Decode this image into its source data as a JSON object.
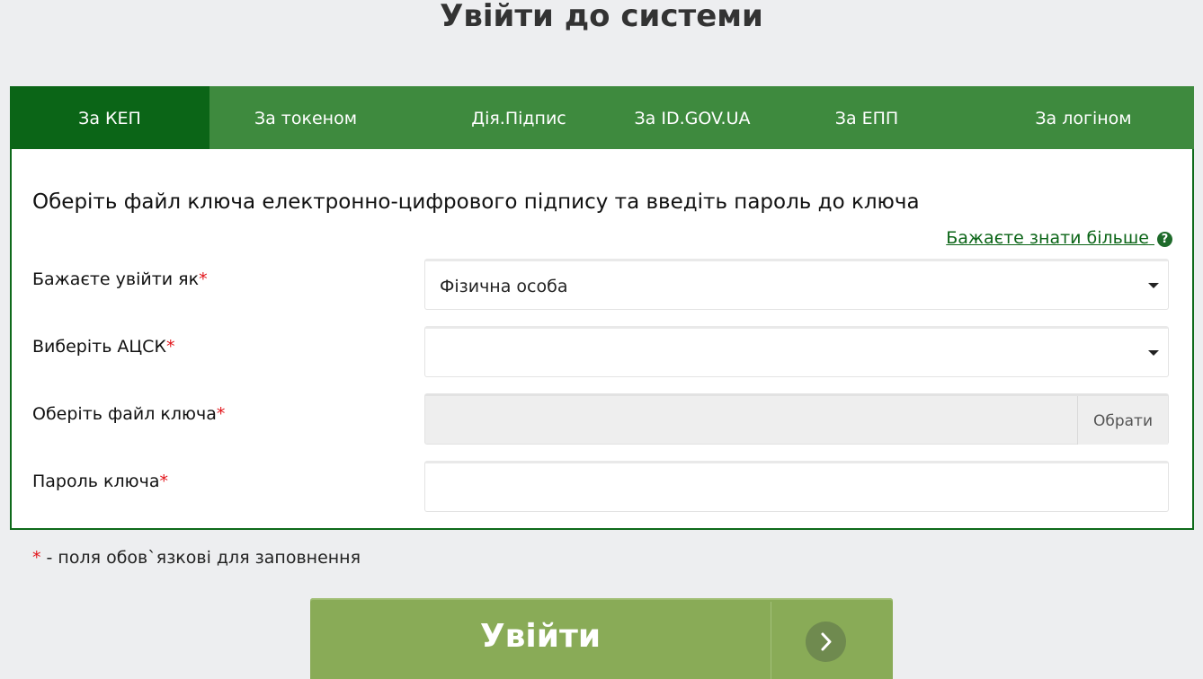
{
  "page": {
    "title": "Увійти до системи"
  },
  "tabs": [
    {
      "label": "За КЕП",
      "active": true
    },
    {
      "label": "За токеном",
      "active": false
    },
    {
      "label": "Дія.Підпис",
      "active": false
    },
    {
      "label": "За ID.GOV.UA",
      "active": false
    },
    {
      "label": "За ЕПП",
      "active": false
    },
    {
      "label": "За логіном",
      "active": false
    }
  ],
  "form": {
    "instruction": "Оберіть файл ключа електронно-цифрового підпису та введіть пароль до ключа",
    "learn_more": "Бажаєте знати більше",
    "required_mark": "*",
    "login_as": {
      "label": "Бажаєте увійти як",
      "value": "Фізична особа"
    },
    "acsk": {
      "label": "Виберіть АЦСК",
      "value": ""
    },
    "key_file": {
      "label": "Оберіть файл ключа",
      "value": "",
      "browse_label": "Обрати"
    },
    "key_password": {
      "label": "Пароль ключа",
      "value": ""
    }
  },
  "footer_note": {
    "mark": "*",
    "text": " - поля обов`язкові для заповнення"
  },
  "login_button": {
    "label": "Увійти"
  },
  "colors": {
    "background": "#edeef0",
    "tab_bar": "#3e8a3e",
    "tab_active": "#0b6517",
    "required": "#e2141a",
    "login_button": "#89ab57"
  },
  "icons": {
    "help": "question-circle-icon",
    "dropdown": "caret-down-icon",
    "login_arrow": "chevron-right-icon"
  }
}
